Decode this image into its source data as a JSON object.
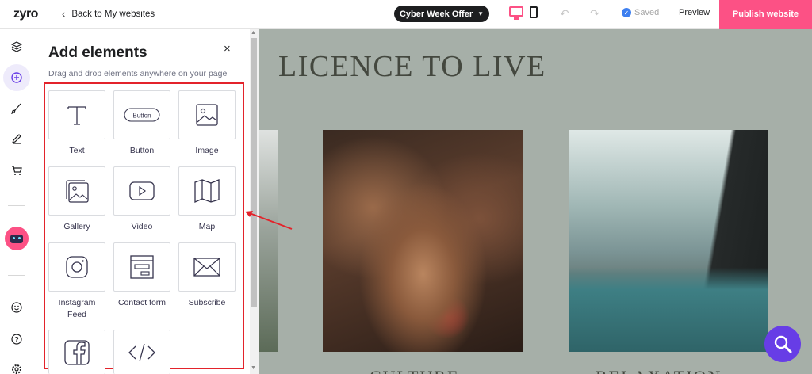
{
  "topbar": {
    "logo": "zyro",
    "back_label": "Back to My websites",
    "offer_label": "Cyber Week Offer",
    "saved_label": "Saved",
    "preview_label": "Preview",
    "publish_label": "Publish website"
  },
  "rail": {
    "items": [
      "layers-icon",
      "add-element-icon",
      "brush-icon",
      "pen-icon",
      "cart-icon",
      "robot-icon",
      "smile-icon",
      "help-icon",
      "settings-icon"
    ]
  },
  "panel": {
    "title": "Add elements",
    "subtitle": "Drag and drop elements anywhere on your page",
    "close": "×",
    "elements": [
      {
        "label": "Text",
        "icon": "text-icon"
      },
      {
        "label": "Button",
        "icon": "button-icon",
        "icon_text": "Button"
      },
      {
        "label": "Image",
        "icon": "image-icon"
      },
      {
        "label": "Gallery",
        "icon": "gallery-icon"
      },
      {
        "label": "Video",
        "icon": "video-icon"
      },
      {
        "label": "Map",
        "icon": "map-icon"
      },
      {
        "label": "Instagram Feed",
        "icon": "instagram-icon"
      },
      {
        "label": "Contact form",
        "icon": "contact-form-icon"
      },
      {
        "label": "Subscribe",
        "icon": "envelope-icon"
      },
      {
        "label": "",
        "icon": "facebook-icon"
      },
      {
        "label": "",
        "icon": "code-icon"
      }
    ]
  },
  "canvas": {
    "site_title": "LICENCE TO LIVE",
    "subheading_1": "CULTURE",
    "subheading_2": "RELAXATION"
  },
  "colors": {
    "brand_pink": "#fc5185",
    "brand_purple": "#673de6",
    "highlight_red": "#e3232b",
    "canvas_bg": "#a6afa8"
  }
}
